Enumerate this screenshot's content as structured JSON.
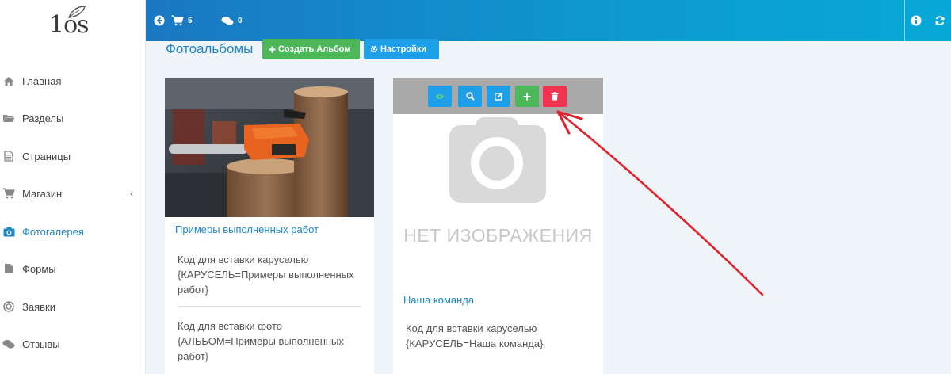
{
  "logo": {
    "text": "1os"
  },
  "sidebar": {
    "items": [
      {
        "label": "Главная",
        "icon": "home-icon"
      },
      {
        "label": "Разделы",
        "icon": "folder-open-icon"
      },
      {
        "label": "Страницы",
        "icon": "file-text-icon"
      },
      {
        "label": "Магазин",
        "icon": "cart-icon",
        "has_submenu": true
      },
      {
        "label": "Фотогалерея",
        "icon": "camera-icon",
        "active": true
      },
      {
        "label": "Формы",
        "icon": "file-icon"
      },
      {
        "label": "Заявки",
        "icon": "target-icon"
      },
      {
        "label": "Отзывы",
        "icon": "comments-icon"
      }
    ],
    "submenu_chevron": "‹"
  },
  "topbar": {
    "cart_count": "5",
    "comments_count": "0"
  },
  "page": {
    "title": "Фотоальбомы",
    "create_button": "Создать Альбом",
    "settings_button": "Настройки"
  },
  "albums": [
    {
      "name": "Примеры выполненных работ",
      "carousel_code": "Код для вставки каруселью {КАРУСЕЛЬ=Примеры выполненных работ}",
      "photo_code": "Код для вставки фото {АЛЬБОМ=Примеры выполненных работ}"
    },
    {
      "name": "Наша команда",
      "no_image_text": "НЕТ ИЗОБРАЖЕНИЯ",
      "carousel_code": "Код для вставки каруселью {КАРУСЕЛЬ=Наша команда}"
    }
  ],
  "colors": {
    "accent": "#1e88c9",
    "green": "#4cb85a",
    "blue": "#1f9fe8",
    "red": "#f0344f",
    "annotation_arrow": "#e3212b"
  }
}
